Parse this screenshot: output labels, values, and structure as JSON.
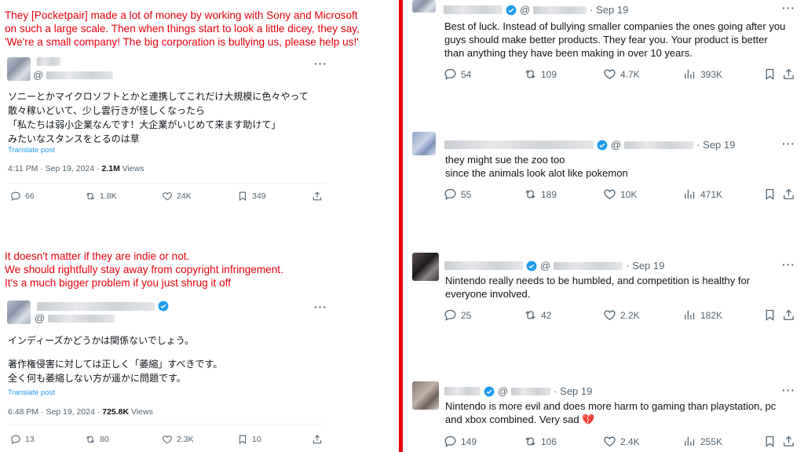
{
  "left": {
    "note1": [
      "They [Pocketpair] made a lot of money by working with Sony and Microsoft",
      "on such a large scale. Then when things start to look a little dicey, they say,",
      "'We're a small company! The big corporation is bullying us, please help us!'"
    ],
    "post1": {
      "handle_prefix": "@",
      "text": [
        "ソニーとかマイクロソフトとかと連携してこれだけ大規模に色々やって",
        "散々稼いどいて、少し雲行きが怪しくなったら",
        "「私たちは弱小企業なんです！大企業がいじめて来ます助けて」",
        "みたいなスタンスをとるのは草"
      ],
      "translate": "Translate post",
      "time": "4:11 PM · Sep 19, 2024 · ",
      "views": "2.1M",
      "views_label": " Views",
      "replies": "66",
      "reposts": "1.8K",
      "likes": "24K",
      "bookmarks": "349"
    },
    "note2": [
      "It doesn't matter if they are indie or not.",
      "We should rightfully stay away from copyright infringement.",
      "It's a much bigger problem if you just shrug it off"
    ],
    "post2": {
      "handle_prefix": "@",
      "text": [
        "インディーズかどうかは関係ないでしょう。",
        "",
        "著作権侵害に対しては正しく「萎縮」すべきです。",
        "全く何も萎縮しない方が遥かに問題です。"
      ],
      "translate": "Translate post",
      "time": "6:48 PM · Sep 19, 2024 · ",
      "views": "725.8K",
      "views_label": " Views",
      "replies": "13",
      "reposts": "80",
      "likes": "2.3K",
      "bookmarks": "10"
    }
  },
  "right": {
    "replies": [
      {
        "date": "· Sep 19",
        "text": [
          "Best of luck. Instead of bullying smaller companies the ones going after you",
          "guys should make better products. They fear you. Your product is better",
          "than anything they have been making in over 10 years."
        ],
        "replies": "54",
        "reposts": "109",
        "likes": "4.7K",
        "views": "393K"
      },
      {
        "date": "· Sep 19",
        "text": [
          "they might sue the zoo too",
          "since the animals look alot like pokemon"
        ],
        "replies": "55",
        "reposts": "189",
        "likes": "10K",
        "views": "471K"
      },
      {
        "date": "· Sep 19",
        "text": [
          "Nintendo really needs to be humbled, and competition is healthy for",
          "everyone involved."
        ],
        "replies": "25",
        "reposts": "42",
        "likes": "2.2K",
        "views": "182K"
      },
      {
        "date": "· Sep 19",
        "text": [
          "Nintendo is more evil and does more harm to gaming than playstation, pc",
          "and xbox combined. Very sad"
        ],
        "emoji": "💔",
        "replies": "149",
        "reposts": "106",
        "likes": "2.4K",
        "views": "255K"
      }
    ]
  },
  "colors": {
    "accent_red": "#e8000d",
    "link_blue": "#1d9bf0",
    "muted": "#536471",
    "verified": "#1d9bf0"
  },
  "icons": [
    "reply-icon",
    "repost-icon",
    "like-icon",
    "bookmark-icon",
    "share-icon",
    "views-icon",
    "verified-icon",
    "more-icon"
  ]
}
